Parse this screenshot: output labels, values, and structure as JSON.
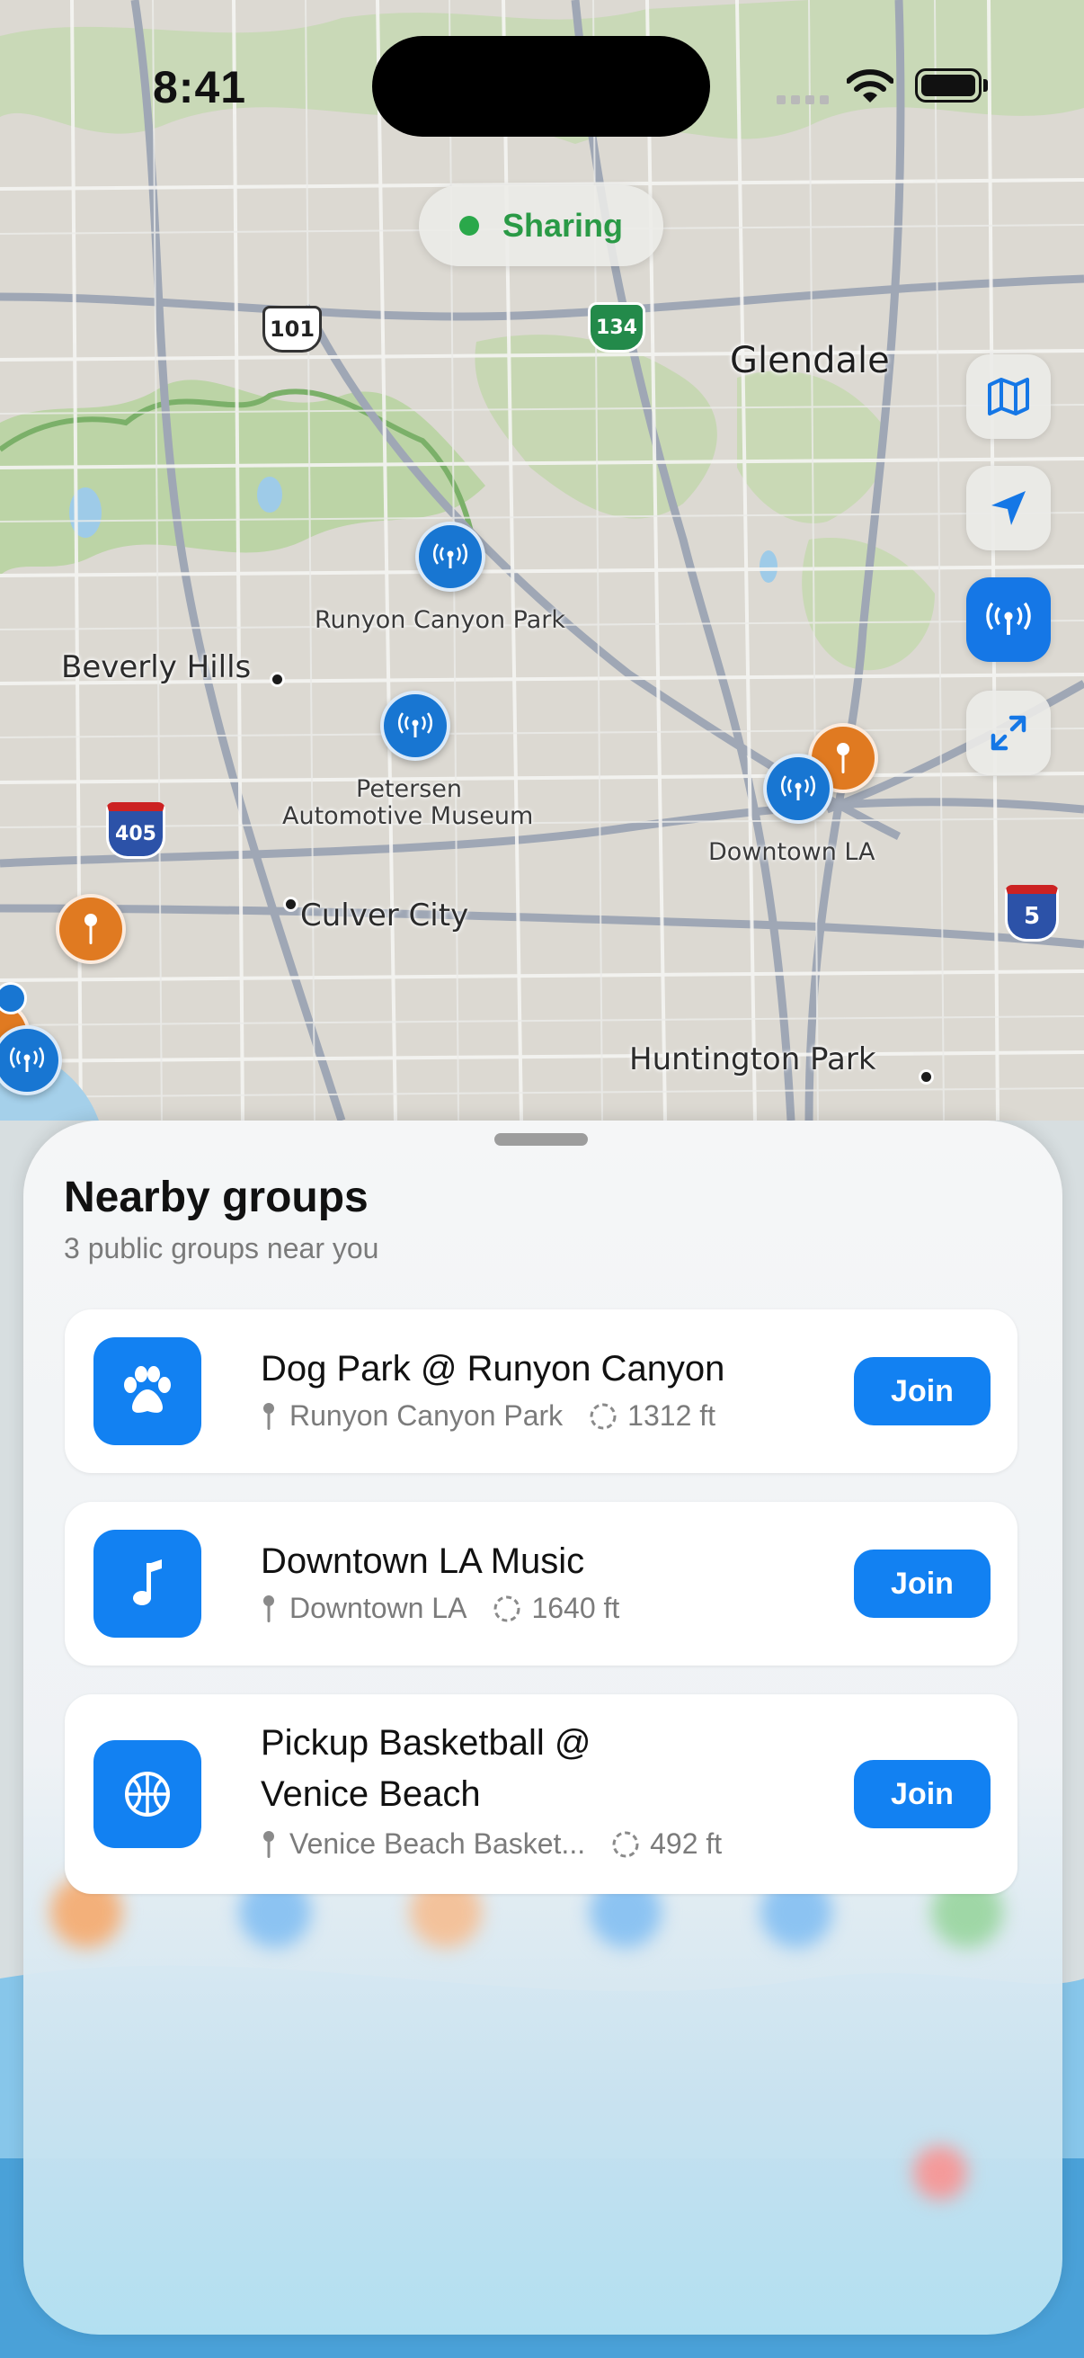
{
  "status_bar": {
    "time": "8:41"
  },
  "sharing": {
    "label": "Sharing",
    "color": "#2aa84a"
  },
  "map": {
    "labels": {
      "glendale": "Glendale",
      "runyon": "Runyon Canyon Park",
      "beverly": "Beverly Hills",
      "petersen": "Petersen",
      "petersen2": "Automotive Museum",
      "downtown": "Downtown LA",
      "culver": "Culver City",
      "huntington": "Huntington Park"
    },
    "shields": {
      "us101": "101",
      "ca134": "134",
      "i405": "405",
      "i5": "5"
    }
  },
  "controls": [
    {
      "icon": "map-icon"
    },
    {
      "icon": "location-arrow-icon"
    },
    {
      "icon": "broadcast-icon",
      "active": true
    },
    {
      "icon": "expand-icon"
    }
  ],
  "sheet": {
    "title": "Nearby groups",
    "subtitle": "3 public groups near you",
    "groups": [
      {
        "icon": "paw-icon",
        "name": "Dog Park @ Runyon Canyon",
        "location": "Runyon Canyon Park",
        "distance": "1312 ft",
        "join": "Join"
      },
      {
        "icon": "music-note-icon",
        "name": "Downtown LA Music",
        "location": "Downtown LA",
        "distance": "1640 ft",
        "join": "Join"
      },
      {
        "icon": "basketball-icon",
        "name_line1": "Pickup Basketball @",
        "name_line2": "Venice Beach",
        "location": "Venice Beach Basket...",
        "distance": "492 ft",
        "join": "Join"
      }
    ]
  },
  "colors": {
    "accent": "#1281f2",
    "pin_blue": "#1876d2",
    "pin_orange": "#e07a21"
  }
}
